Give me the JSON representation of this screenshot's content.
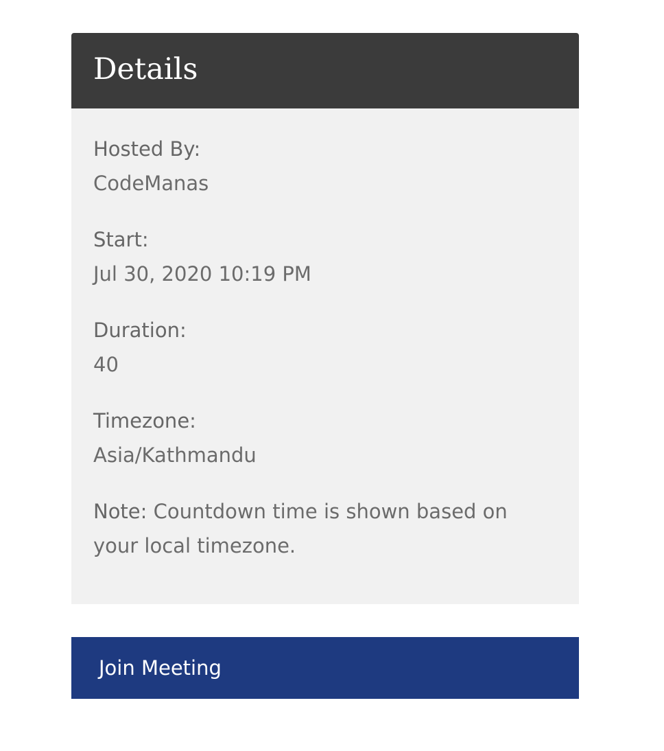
{
  "details": {
    "title": "Details",
    "hosted_by": {
      "label": "Hosted By:",
      "value": "CodeManas"
    },
    "start": {
      "label": "Start:",
      "value": "Jul 30, 2020 10:19 PM"
    },
    "duration": {
      "label": "Duration:",
      "value": "40"
    },
    "timezone": {
      "label": "Timezone:",
      "value": "Asia/Kathmandu"
    },
    "note": {
      "label": "Note:",
      "text": "Countdown time is shown based on your local timezone."
    }
  },
  "actions": {
    "join_label": "Join Meeting"
  },
  "colors": {
    "header_background": "#3b3b3b",
    "body_background": "#f1f1f1",
    "text": "#6b6b6b",
    "join_button": "#1e3a80"
  }
}
